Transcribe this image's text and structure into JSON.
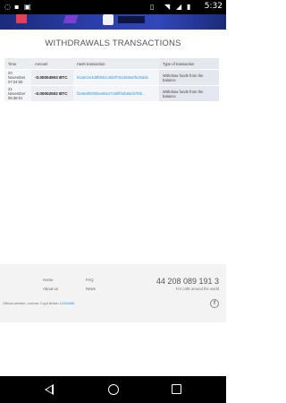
{
  "status_bar": {
    "time": "5:32",
    "left_icons": [
      "whatsapp-icon",
      "notification-icon",
      "image-icon"
    ],
    "right_icons": [
      "vibrate-icon",
      "wifi-icon",
      "signal-icon",
      "battery-icon"
    ]
  },
  "page": {
    "title": "WITHDRAWALS TRANSACTIONS"
  },
  "table": {
    "headers": [
      "Time",
      "Amount",
      "Hash transaction",
      "Type of transaction"
    ],
    "rows": [
      {
        "time": "20 November 07:24:50",
        "amount": "-0.00004903 BTC",
        "hash": "81a9c2e4d8f0b51c9d3f7251b68a0fe29d4b",
        "type": "Withdraw funds from the balance"
      },
      {
        "time": "21 November 06:38:01",
        "amount": "-0.00002502 BTC",
        "hash": "f2e8a9f030b6e69e27c58ff34b68d47f8b...",
        "type": "Withdraw funds from the balance"
      }
    ]
  },
  "footer": {
    "links": [
      "Home",
      "FAQ",
      "About us",
      "News"
    ],
    "phone": "44 208 089 191 3",
    "phone_sub": "For calls around the world",
    "copyright_text": "Official website, License Crypt Britain ",
    "copyright_link": "11826586",
    "social_icon": "facebook-icon",
    "social_glyph": "f"
  },
  "colors": {
    "banner": "#2a3ea8",
    "link": "#2b9be0",
    "footer_bg": "#f3f3f3"
  }
}
